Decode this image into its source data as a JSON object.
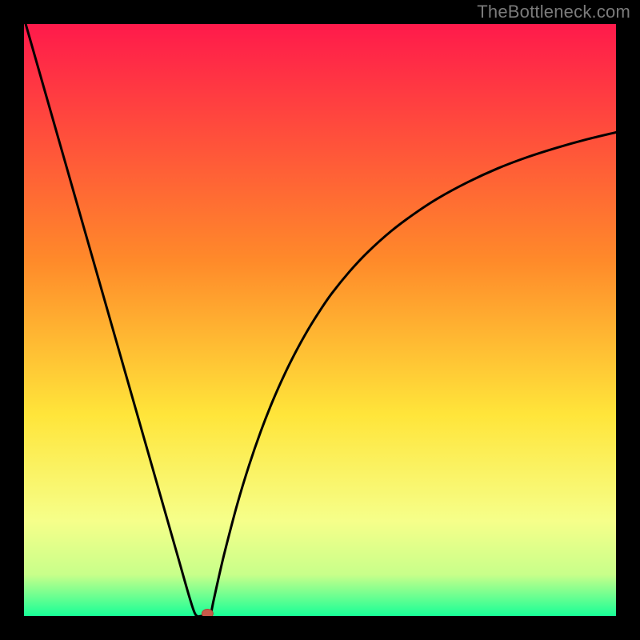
{
  "watermark": "TheBottleneck.com",
  "colors": {
    "frame": "#000000",
    "watermark": "#7b7b7b",
    "curve": "#000000",
    "marker_fill": "#c85a4a",
    "marker_stroke": "#b14235",
    "grad_top": "#ff1a4b",
    "grad_mid1": "#ff8a2a",
    "grad_mid2": "#ffe53a",
    "grad_mid3": "#f6ff8a",
    "grad_mid4": "#c8ff8a",
    "grad_bottom": "#18ff97"
  },
  "chart_data": {
    "type": "line",
    "title": "",
    "xlabel": "",
    "ylabel": "",
    "xlim": [
      0,
      100
    ],
    "ylim": [
      0,
      100
    ],
    "x": [
      0,
      2,
      4,
      6,
      8,
      10,
      12,
      14,
      16,
      18,
      20,
      22,
      24,
      26,
      28,
      29,
      30,
      31,
      31.5,
      32,
      33,
      34,
      36,
      38,
      40,
      42,
      44,
      46,
      48,
      50,
      52,
      55,
      58,
      62,
      66,
      70,
      75,
      80,
      85,
      90,
      95,
      100
    ],
    "values": [
      101,
      94.0,
      87.0,
      80.0,
      73.0,
      66.0,
      59.0,
      52.0,
      45.0,
      38.0,
      31.0,
      24.0,
      17.0,
      10.0,
      3.0,
      0.2,
      0.0,
      0.0,
      0.2,
      2.5,
      7.0,
      11.2,
      18.8,
      25.4,
      31.2,
      36.3,
      40.8,
      44.8,
      48.4,
      51.6,
      54.5,
      58.2,
      61.4,
      65.0,
      68.0,
      70.6,
      73.3,
      75.6,
      77.5,
      79.1,
      80.5,
      81.7
    ],
    "marker": {
      "x": 31,
      "y": 0.4
    },
    "notes": "V-shaped bottleneck curve on a vertical red→green gradient background; minimum near x≈30; right branch rises as a saturating curve."
  }
}
